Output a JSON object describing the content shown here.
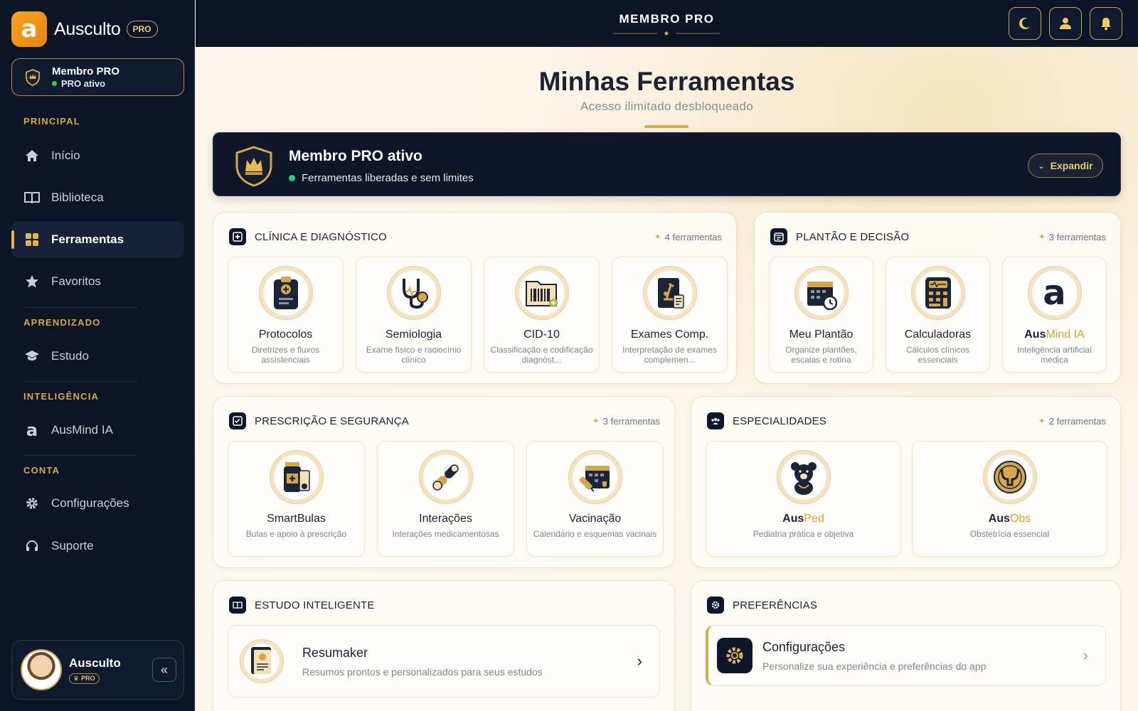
{
  "brand": {
    "name": "Ausculto",
    "badge": "PRO",
    "logo_glyph": "a"
  },
  "member_card": {
    "title": "Membro PRO",
    "status": "PRO ativo"
  },
  "sidebar": {
    "sections": {
      "principal": "PRINCIPAL",
      "aprendizado": "APRENDIZADO",
      "inteligencia": "INTELIGÊNCIA",
      "conta": "CONTA"
    },
    "items": [
      {
        "label": "Início",
        "icon": "home-icon"
      },
      {
        "label": "Biblioteca",
        "icon": "book-icon"
      },
      {
        "label": "Ferramentas",
        "icon": "grid-icon",
        "active": true
      },
      {
        "label": "Favoritos",
        "icon": "star-icon"
      },
      {
        "label": "Estudo",
        "icon": "graduation-cap-icon"
      },
      {
        "label": "AusMind IA",
        "icon": "ai-icon"
      },
      {
        "label": "Configurações",
        "icon": "gear-icon"
      },
      {
        "label": "Suporte",
        "icon": "headset-icon"
      }
    ]
  },
  "user": {
    "name": "Ausculto",
    "badge": "PRO"
  },
  "topbar": {
    "title": "MEMBRO PRO"
  },
  "page": {
    "title": "Minhas Ferramentas",
    "subtitle": "Acesso ilimitado desbloqueado"
  },
  "banner": {
    "title": "Membro PRO ativo",
    "subtitle": "Ferramentas liberadas e sem limites",
    "button": "Expandir"
  },
  "panels": {
    "clinica": {
      "title": "CLÍNICA E DIAGNÓSTICO",
      "count": "4 ferramentas",
      "tools": [
        {
          "name": "Protocolos",
          "desc": "Diretrizes e fluxos assistenciais"
        },
        {
          "name": "Semiologia",
          "desc": "Exame físico e raciocínio clínico"
        },
        {
          "name": "CID-10",
          "desc": "Classificação e codificação diagnóst..."
        },
        {
          "name": "Exames Comp.",
          "desc": "Interpretação de exames complemen..."
        }
      ]
    },
    "plantao": {
      "title": "PLANTÃO E DECISÃO",
      "count": "3 ferramentas",
      "tools": [
        {
          "name": "Meu Plantão",
          "desc": "Organize plantões, escalas e rotina"
        },
        {
          "name": "Calculadoras",
          "desc": "Cálculos clínicos essenciais"
        },
        {
          "name_a": "Aus",
          "name_b": "Mind IA",
          "desc": "Inteligência artificial médica"
        }
      ]
    },
    "prescricao": {
      "title": "PRESCRIÇÃO E SEGURANÇA",
      "count": "3 ferramentas",
      "tools": [
        {
          "name": "SmartBulas",
          "desc": "Bulas e apoio à prescrição"
        },
        {
          "name": "Interações",
          "desc": "Interações medicamentosas"
        },
        {
          "name": "Vacinação",
          "desc": "Calendário e esquemas vacinais"
        }
      ]
    },
    "especialidades": {
      "title": "ESPECIALIDADES",
      "count": "2 ferramentas",
      "tools": [
        {
          "name_a": "Aus",
          "name_b": "Ped",
          "desc": "Pediatria prática e objetiva"
        },
        {
          "name_a": "Aus",
          "name_b": "Obs",
          "desc": "Obstetrícia essencial"
        }
      ]
    },
    "estudo": {
      "title": "ESTUDO INTELIGENTE",
      "item": {
        "title": "Resumaker",
        "desc": "Resumos prontos e personalizados para seus estudos"
      }
    },
    "preferencias": {
      "title": "PREFERÊNCIAS",
      "item": {
        "title": "Configurações",
        "desc": "Personalize sua experiência e preferências do app"
      }
    }
  },
  "colors": {
    "navy": "#0c1526",
    "gold": "#d9a52e",
    "accent_green": "#2ecc71"
  }
}
